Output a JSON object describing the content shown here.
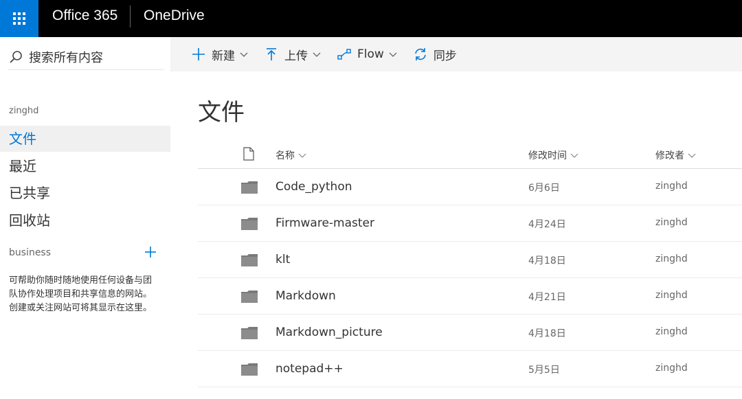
{
  "header": {
    "brand": "Office 365",
    "app": "OneDrive",
    "waffle_icon": "app-launcher-icon"
  },
  "colors": {
    "header_bg": "#000000",
    "waffle_bg": "#0078d7",
    "accent": "#0078d7",
    "commandbar_bg": "#f4f4f4"
  },
  "sidebar": {
    "search_placeholder": "搜索所有内容",
    "user": "zinghd",
    "items": [
      {
        "label": "文件",
        "active": true
      },
      {
        "label": "最近",
        "active": false
      },
      {
        "label": "已共享",
        "active": false
      },
      {
        "label": "回收站",
        "active": false
      }
    ],
    "section_title": "business",
    "section_description": "可帮助你随时随地使用任何设备与团队协作处理项目和共享信息的网站。创建或关注网站可将其显示在这里。"
  },
  "commandbar": {
    "new_label": "新建",
    "upload_label": "上传",
    "flow_label": "Flow",
    "sync_label": "同步"
  },
  "main": {
    "title": "文件",
    "columns": {
      "name": "名称",
      "modified": "修改时间",
      "modified_by": "修改者"
    },
    "files": [
      {
        "name": "Code_python",
        "modified": "6月6日",
        "modified_by": "zinghd"
      },
      {
        "name": "Firmware-master",
        "modified": "4月24日",
        "modified_by": "zinghd"
      },
      {
        "name": "klt",
        "modified": "4月18日",
        "modified_by": "zinghd"
      },
      {
        "name": "Markdown",
        "modified": "4月21日",
        "modified_by": "zinghd"
      },
      {
        "name": "Markdown_picture",
        "modified": "4月18日",
        "modified_by": "zinghd"
      },
      {
        "name": "notepad++",
        "modified": "5月5日",
        "modified_by": "zinghd"
      }
    ]
  }
}
